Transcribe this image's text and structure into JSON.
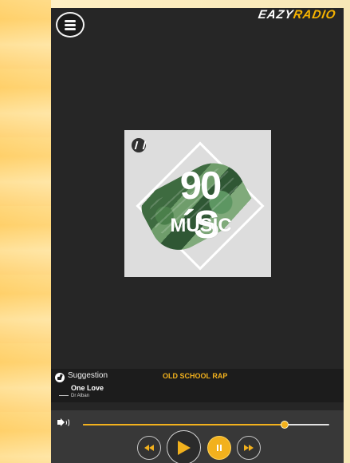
{
  "header": {
    "brand_left": "EAZY",
    "brand_right": "RADIO"
  },
  "cover": {
    "title_main": "90´S",
    "title_sub": "MUSIC"
  },
  "suggestion": {
    "label": "Suggestion",
    "station": "OLD SCHOOL RAP",
    "song": "One Love",
    "artist": "Dr Alban"
  },
  "player": {
    "volume_level": 0.82
  },
  "icons": {
    "menu": "menu-icon",
    "suggestion": "thumbs-up-icon",
    "volume": "volume-icon",
    "rewind": "rewind-icon",
    "play": "play-icon",
    "pause": "pause-icon",
    "forward": "forward-icon"
  },
  "colors": {
    "accent": "#f2b11d",
    "background": "#262626",
    "controls": "#383838"
  }
}
